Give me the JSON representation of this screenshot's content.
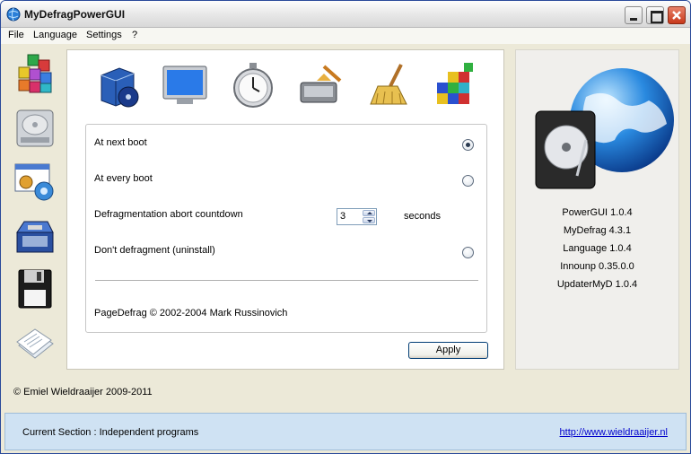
{
  "window": {
    "title": "MyDefragPowerGUI"
  },
  "menu": {
    "items": [
      "File",
      "Language",
      "Settings",
      "?"
    ]
  },
  "sidebar": {
    "items": [
      {
        "icon": "defrag-blocks-icon"
      },
      {
        "icon": "hard-drive-icon"
      },
      {
        "icon": "settings-window-icon"
      },
      {
        "icon": "toolbox-icon"
      },
      {
        "icon": "floppy-disk-icon"
      },
      {
        "icon": "documents-icon"
      }
    ]
  },
  "toolbar": {
    "icons": [
      "software-box-icon",
      "monitor-icon",
      "stopwatch-icon",
      "drive-cleanup-icon",
      "broom-icon",
      "cubes-icon"
    ]
  },
  "options": {
    "at_next_boot": {
      "label": "At next boot",
      "checked": true
    },
    "at_every_boot": {
      "label": "At every boot",
      "checked": false
    },
    "countdown": {
      "label": "Defragmentation abort countdown",
      "value": "3",
      "unit": "seconds"
    },
    "dont_defrag": {
      "label": "Don't defragment (uninstall)",
      "checked": false
    },
    "copyright": "PageDefrag © 2002-2004 Mark Russinovich"
  },
  "apply_label": "Apply",
  "versions": [
    "PowerGUI 1.0.4",
    "MyDefrag 4.3.1",
    "Language 1.0.4",
    "Innounp 0.35.0.0",
    "UpdaterMyD 1.0.4"
  ],
  "author": "© Emiel Wieldraaijer 2009-2011",
  "status": {
    "text": "Current Section : Independent programs",
    "link": "http://www.wieldraaijer.nl"
  },
  "colors": {
    "status_bg": "#cfe2f3",
    "link": "#0000cc",
    "close_btn": "#c8391b"
  }
}
